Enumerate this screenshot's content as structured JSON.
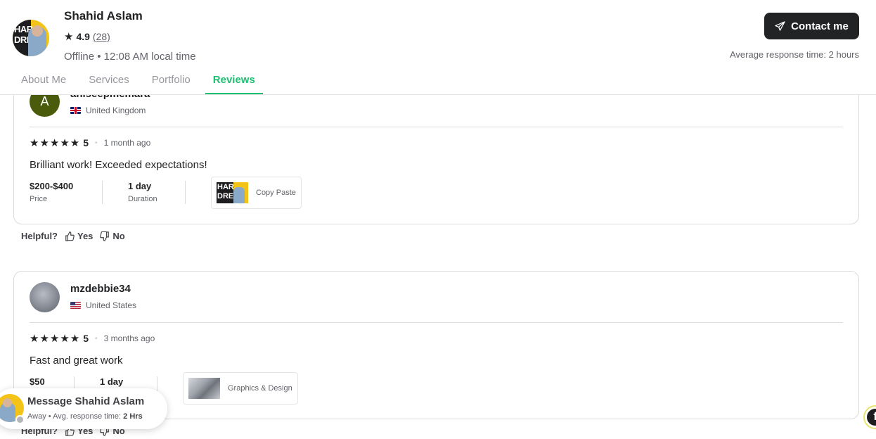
{
  "seller": {
    "name": "Shahid Aslam",
    "rating": "4.9",
    "rating_count": "(28)",
    "status": "Offline • 12:08 AM local time",
    "contact_label": "Contact me",
    "avg_response": "Average response time: 2 hours",
    "avatar_text": "HAR\nDRE"
  },
  "tabs": [
    "About Me",
    "Services",
    "Portfolio",
    "Reviews"
  ],
  "active_tab": "Reviews",
  "colors": {
    "accent": "#1dbf73",
    "dark": "#222325",
    "muted": "#62646a"
  },
  "reviews": [
    {
      "initial": "A",
      "username": "aniseepmemara",
      "country": "United Kingdom",
      "stars": "★★★★★",
      "score": "5",
      "time_ago": "1 month ago",
      "text": "Brilliant work! Exceeded expectations!",
      "price": "$200-$400",
      "price_label": "Price",
      "duration": "1 day",
      "duration_label": "Duration",
      "gig_title": "Copy Paste",
      "gig_thumb_text": "HAR\nDRE"
    },
    {
      "initial": "",
      "username": "mzdebbie34",
      "country": "United States",
      "stars": "★★★★★",
      "score": "5",
      "time_ago": "3 months ago",
      "text": "Fast and great work",
      "price": "$50",
      "duration": "1 day",
      "gig_title": "Graphics & Design"
    }
  ],
  "helpful": {
    "label": "Helpful?",
    "yes": "Yes",
    "no": "No"
  },
  "message_box": {
    "title": "Message Shahid Aslam",
    "status": "Away",
    "sep": "•",
    "response_label": "Avg. response time:",
    "response_value": "2 Hrs"
  },
  "fab": {
    "letter": "f"
  }
}
